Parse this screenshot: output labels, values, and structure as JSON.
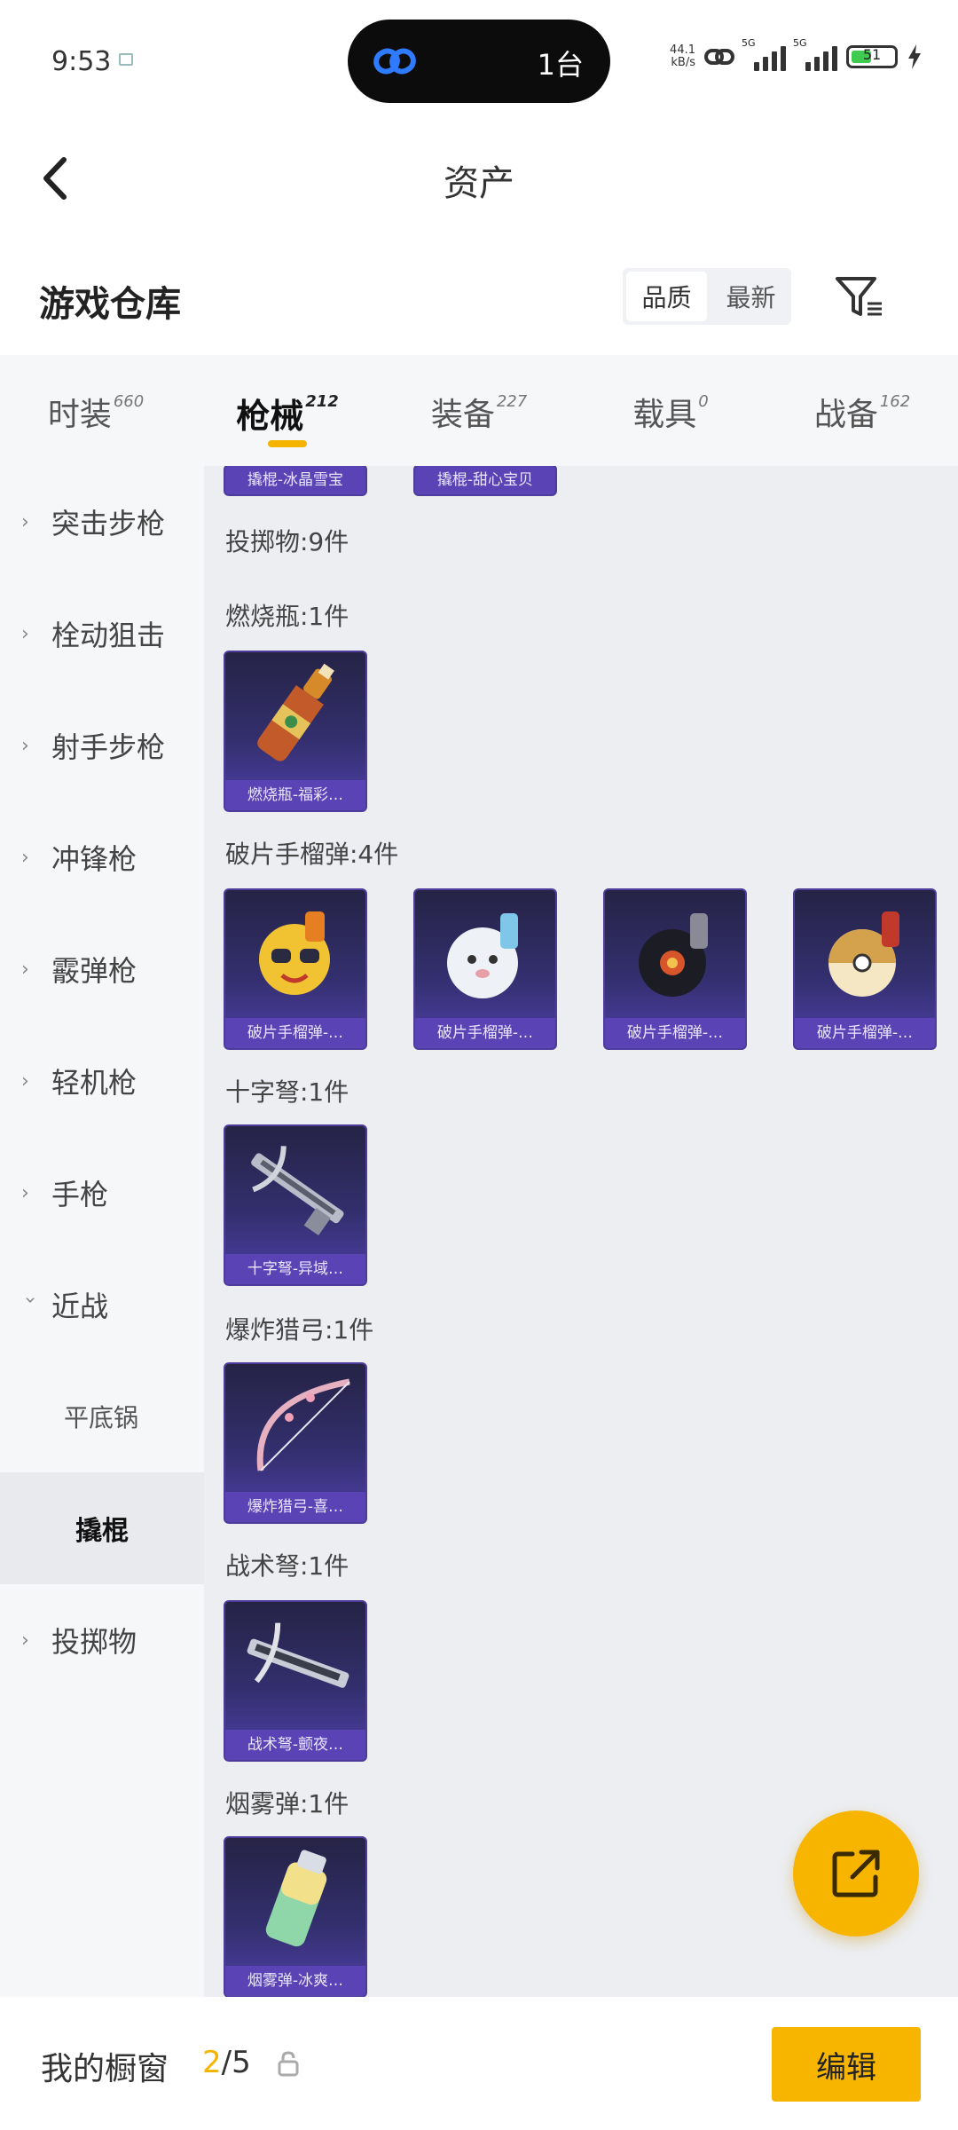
{
  "status_bar": {
    "time": "9:53",
    "island_text": "1台",
    "net_speed_top": "44.1",
    "net_speed_bottom": "kB/s",
    "sim1": "5G",
    "sim2": "5G",
    "battery": "51"
  },
  "header": {
    "title": "资产"
  },
  "warehouse": {
    "title": "游戏仓库",
    "sort_options": [
      "品质",
      "最新"
    ],
    "active_sort": "品质"
  },
  "tabs": [
    {
      "label": "时装",
      "count": "660"
    },
    {
      "label": "枪械",
      "count": "212",
      "active": true
    },
    {
      "label": "装备",
      "count": "227"
    },
    {
      "label": "载具",
      "count": "0"
    },
    {
      "label": "战备",
      "count": "162"
    }
  ],
  "sidebar": [
    {
      "label": "突击步枪",
      "type": "collapsed"
    },
    {
      "label": "栓动狙击",
      "type": "collapsed"
    },
    {
      "label": "射手步枪",
      "type": "collapsed"
    },
    {
      "label": "冲锋枪",
      "type": "collapsed"
    },
    {
      "label": "霰弹枪",
      "type": "collapsed"
    },
    {
      "label": "轻机枪",
      "type": "collapsed"
    },
    {
      "label": "手枪",
      "type": "collapsed"
    },
    {
      "label": "近战",
      "type": "expanded"
    },
    {
      "label": "平底锅",
      "type": "sub"
    },
    {
      "label": "撬棍",
      "type": "active"
    },
    {
      "label": "投掷物",
      "type": "collapsed"
    }
  ],
  "content": {
    "top_partial_items": [
      "撬棍-冰晶雪宝",
      "撬棍-甜心宝贝"
    ],
    "sections": [
      {
        "label": "投掷物:9件",
        "items": []
      },
      {
        "label": "燃烧瓶:1件",
        "items": [
          {
            "name": "燃烧瓶-福彩…",
            "art": "molotov"
          }
        ]
      },
      {
        "label": "破片手榴弹:4件",
        "items": [
          {
            "name": "破片手榴弹-…",
            "art": "grenade-yellow"
          },
          {
            "name": "破片手榴弹-…",
            "art": "grenade-white"
          },
          {
            "name": "破片手榴弹-…",
            "art": "grenade-black"
          },
          {
            "name": "破片手榴弹-…",
            "art": "grenade-gold"
          }
        ]
      },
      {
        "label": "十字弩:1件",
        "items": [
          {
            "name": "十字弩-异域…",
            "art": "crossbow"
          }
        ]
      },
      {
        "label": "爆炸猎弓:1件",
        "items": [
          {
            "name": "爆炸猎弓-喜…",
            "art": "bow"
          }
        ]
      },
      {
        "label": "战术弩:1件",
        "items": [
          {
            "name": "战术弩-颤夜…",
            "art": "tactical-crossbow"
          }
        ]
      },
      {
        "label": "烟雾弹:1件",
        "items": [
          {
            "name": "烟雾弹-冰爽…",
            "art": "smoke"
          }
        ]
      }
    ]
  },
  "bottom_bar": {
    "window_label": "我的橱窗",
    "window_current": "2",
    "window_total": "/5",
    "edit_label": "编辑"
  },
  "colors": {
    "accent": "#f7b500",
    "card_name_bg": "#5a43b5"
  }
}
